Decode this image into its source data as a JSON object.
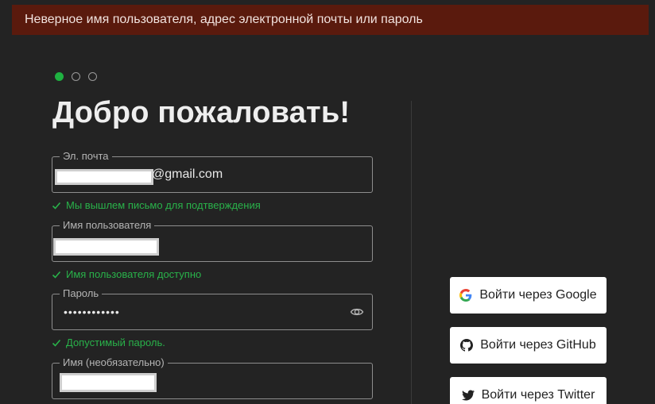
{
  "error_banner": {
    "text": "Неверное имя пользователя, адрес электронной почты или пароль",
    "bg_color": "#5a1a0d"
  },
  "steps": {
    "total": 3,
    "current": 1,
    "active_color": "#1fb141"
  },
  "title": "Добро пожаловать!",
  "form": {
    "email": {
      "label": "Эл. почта",
      "value_suffix": "@gmail.com",
      "status": "Мы вышлем письмо для подтверждения"
    },
    "username": {
      "label": "Имя пользователя",
      "status": "Имя пользователя доступно"
    },
    "password": {
      "label": "Пароль",
      "value_masked": "••••••••••••",
      "status": "Допустимый пароль.",
      "toggle_icon": "eye-icon"
    },
    "name": {
      "label": "Имя (необязательно)"
    },
    "valid_color": "#29b24a"
  },
  "oauth": {
    "google": {
      "label": "Войти через Google",
      "icon": "google-icon"
    },
    "github": {
      "label": "Войти через GitHub",
      "icon": "github-icon"
    },
    "twitter": {
      "label": "Войти через Twitter",
      "icon": "twitter-icon"
    }
  }
}
